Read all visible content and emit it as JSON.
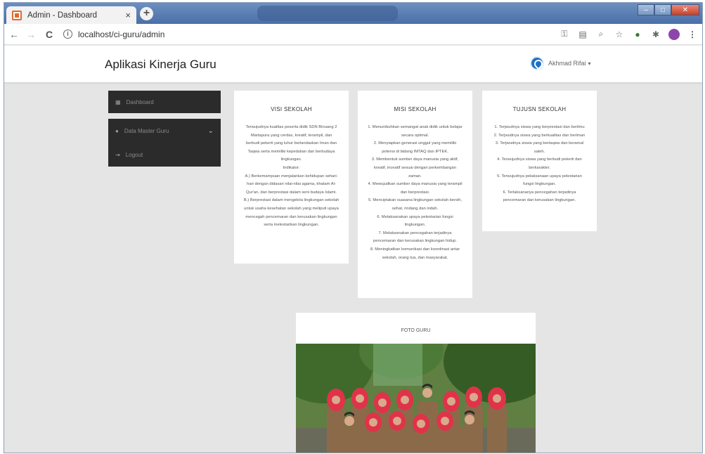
{
  "browser": {
    "tab_title": "Admin - Dashboard",
    "tab_close": "×",
    "new_tab": "+",
    "url": "localhost/ci-guru/admin"
  },
  "app": {
    "brand": "Aplikasi Kinerja Guru",
    "user": {
      "name": "Akhmad Rifai",
      "caret": "▾"
    }
  },
  "sidebar": {
    "items": [
      {
        "label": "Dashboard",
        "icon": "dashboard-icon"
      },
      {
        "label": "Data Master Guru",
        "icon": "circle-icon"
      },
      {
        "label": "Logout",
        "icon": "logout-icon"
      }
    ]
  },
  "cards": {
    "visi": {
      "title": "VISI SEKOLAH",
      "lines": [
        "Terwujudnya kualitas peserta didik SDN Binuang 2",
        "Martapura yang cerdas, kreatif, terampil, dan",
        "berbudi pekerti yang luhur berlandaskan Iman dan",
        "Taqwa serta memiliki kepedulian dan berbudaya",
        "lingkungan.",
        "Indikator:",
        "A.) Berkemampuan menjalankan kehidupan sehari-",
        "hari dengan didasari nilai-nilai agama, khatam Al-",
        "Qur'an, dan berprestasi dalam seni budaya Islami.",
        "B.) Berprestasi dalam mengelola lingkungan sekolah",
        "untuk usaha kesehatan sekolah yang meliputi upaya",
        "mencegah pencemaran dan kerusakan lingkungan",
        "serta melestarikan lingkungan."
      ]
    },
    "misi": {
      "title": "MISI SEKOLAH",
      "lines": [
        "1. Menumbuhkan semangat anak didik untuk belajar",
        "secara optimal.",
        "2. Menyiapkan generasi unggul yang memiliki",
        "potensi di bidang IMTAQ dan IPTEK.",
        "3. Membentuk sumber daya manusia yang aktif,",
        "kreatif, inovatif sesuai dengan perkembangan",
        "zaman.",
        "4. Mewujudkan sumber daya manusia yang terampil",
        "dan berprestasi.",
        "5. Menciptakan suasana lingkungan sekolah bersih,",
        "sehat, rindang dan indah.",
        "6. Melaksanakan upaya pelestarian fungsi",
        "lingkungan.",
        "7. Melaksanakan pencegahan terjadinya",
        "pencemaran dan kerusakan lingkungan hidup.",
        "8. Meningkatkan komunikasi dan koordinasi antar",
        "sekolah, orang tua, dan masyarakat."
      ]
    },
    "tujuan": {
      "title": "TUJUSN SEKOLAH",
      "lines": [
        "1. Terjwudnya siswa yang berprestasi dan berilmu",
        "2. Terjwudnya siswa yang berkualitas dan beriman",
        "3. Terjwudnya siswa yang bertaqwa dan beramal",
        "saleh.",
        "4. Terwujudnya siswa yang berbudi pekerti dan",
        "berkarakter.",
        "5. Terwujudnya pelaksanaan upaya pelestarian",
        "fungsi lingkungan.",
        "6. Terlaksananya pencegahan terjadinya",
        "pencemaran dan kerusakan lingkungan."
      ]
    }
  },
  "photo_card": {
    "title": "FOTO GURU"
  },
  "colors": {
    "sidebar_bg": "#2b2b2b",
    "page_bg": "#e5e5e5",
    "accent_blue": "#1f6fc4",
    "uniform": "#8b6a4a",
    "hijab": "#e0334a"
  }
}
